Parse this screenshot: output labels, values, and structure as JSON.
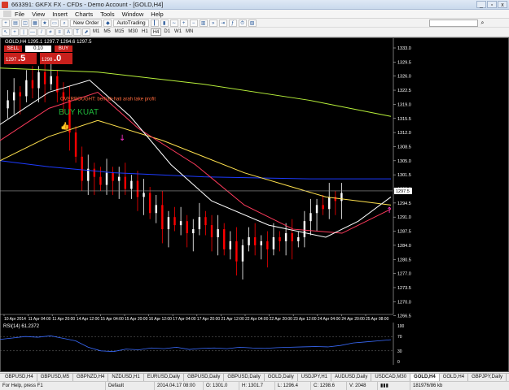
{
  "window": {
    "title": "663391: GKFX FX - CFDs - Demo Account - [GOLD,H4]",
    "controls": [
      "_",
      "▫",
      "x"
    ]
  },
  "menu": [
    "File",
    "View",
    "Insert",
    "Charts",
    "Tools",
    "Window",
    "Help"
  ],
  "toolbar": {
    "new_order": "New Order",
    "autotrading": "AutoTrading",
    "timeframes": [
      "M1",
      "M5",
      "M15",
      "M30",
      "H1",
      "H4",
      "D1",
      "W1",
      "MN"
    ]
  },
  "chart": {
    "title": "GOLD,H4  1295.1 1297.7 1294.6 1297.5",
    "bg": "#000000",
    "one_click": {
      "sell_label": "SELL",
      "buy_label": "BUY",
      "lot": "0.10",
      "sell_price_prefix": "1297",
      "sell_price_big": ".5",
      "buy_price_prefix": "1298",
      "buy_price_big": ".0"
    },
    "annotations": {
      "overbought": "OVERBOUGHT: berhati-hati arah take profit",
      "buy_signal": "BUY KUAT"
    },
    "price_axis": [
      "1333.0",
      "1329.5",
      "1326.0",
      "1322.5",
      "1319.0",
      "1315.5",
      "1312.0",
      "1308.5",
      "1305.0",
      "1301.5",
      "1298.0",
      "1294.5",
      "1291.0",
      "1287.5",
      "1284.0",
      "1280.5",
      "1277.0",
      "1273.5",
      "1270.0",
      "1266.5"
    ],
    "current_price_tag": "1297.5",
    "time_axis": [
      "10 Apr 2014",
      "11 Apr 04:00",
      "11 Apr 20:00",
      "14 Apr 12:00",
      "15 Apr 04:00",
      "15 Apr 20:00",
      "16 Apr 12:00",
      "17 Apr 04:00",
      "17 Apr 20:00",
      "21 Apr 12:00",
      "22 Apr 04:00",
      "22 Apr 20:00",
      "23 Apr 12:00",
      "24 Apr 04:00",
      "24 Apr 20:00",
      "25 Apr 08:00"
    ],
    "colors": {
      "up": "#ffffff",
      "down": "#ff0000",
      "ma_white": "#ffffff",
      "ma_red": "#ff3b5c",
      "ma_yellow": "#ffe14d",
      "ma_blue": "#1d3bff",
      "ma_green": "#b7f03a",
      "arrow": "#ff33cc"
    }
  },
  "rsi": {
    "label": "RSI(14) 61.2372",
    "levels": [
      "100",
      "70",
      "30",
      "0"
    ]
  },
  "tabs": [
    "GBPUSD,H4",
    "GBPUSD,M5",
    "GBPNZD,H4",
    "NZDUSD,H1",
    "EURUSD,Daily",
    "GBPUSD,Daily",
    "GBPUSD,Daily",
    "GOLD,Daily",
    "USDJPY,H1",
    "AUDUSD,Daily",
    "USDCAD,M30",
    "GOLD,H4",
    "GOLD,H4",
    "GBPJPY,Daily"
  ],
  "active_tab_index": 11,
  "status": {
    "help": "For Help, press F1",
    "profile": "Default",
    "datetime": "2014.04.17 08:00",
    "open": "O: 1301.0",
    "high": "H: 1301.7",
    "low": "L: 1296.4",
    "close": "C: 1298.6",
    "volume": "V: 2048",
    "traffic": "181976/86 kb"
  }
}
